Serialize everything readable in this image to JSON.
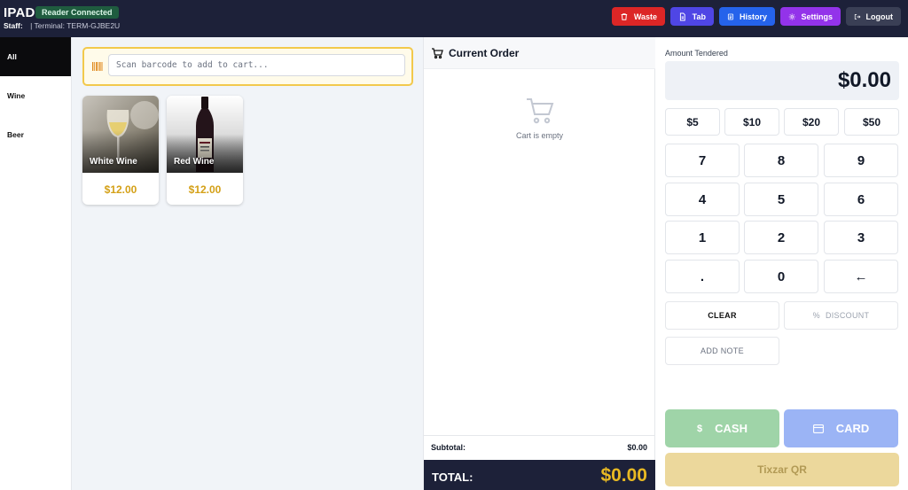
{
  "header": {
    "brand": "IPAD",
    "reader_status": "Reader Connected",
    "staff_label": "Staff:",
    "terminal": "| Terminal: TERM-GJBE2U",
    "buttons": {
      "waste": "Waste",
      "tab": "Tab",
      "history": "History",
      "settings": "Settings",
      "logout": "Logout"
    }
  },
  "categories": [
    "All",
    "Wine",
    "Beer"
  ],
  "search": {
    "placeholder": "Scan barcode to add to cart..."
  },
  "products": [
    {
      "name": "White Wine",
      "price": "$12.00"
    },
    {
      "name": "Red Wine",
      "price": "$12.00"
    }
  ],
  "order": {
    "title": "Current Order",
    "empty_text": "Cart is empty",
    "subtotal_label": "Subtotal:",
    "subtotal_value": "$0.00",
    "total_label": "TOTAL:",
    "total_value": "$0.00"
  },
  "payment": {
    "amount_label": "Amount Tendered",
    "amount_value": "$0.00",
    "quick_amounts": [
      "$5",
      "$10",
      "$20",
      "$50"
    ],
    "keypad": [
      "7",
      "8",
      "9",
      "4",
      "5",
      "6",
      "1",
      "2",
      "3",
      ".",
      "0",
      "←"
    ],
    "clear": "CLEAR",
    "discount": "DISCOUNT",
    "discount_icon_text": "%",
    "add_note": "ADD NOTE",
    "cash": "CASH",
    "cash_icon_text": "$",
    "card": "CARD",
    "qr": "Tixzar QR"
  },
  "colors": {
    "header_bg": "#1d2139",
    "waste": "#dc2626",
    "tab": "#4f46e5",
    "history": "#2563eb",
    "settings": "#9333ea",
    "logout": "#3a3f55",
    "price": "#d4a017",
    "cash": "#9fd4a8",
    "card": "#9bb4f5",
    "qr": "#ecd89c"
  }
}
